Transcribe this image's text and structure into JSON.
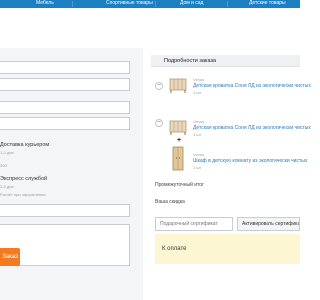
{
  "nav": {
    "items": [
      "Мебель",
      "Спортивные товары",
      "Дом и сад",
      "Детские товары"
    ]
  },
  "form": {
    "delivery_courier_label": "Доставка курьером",
    "delivery_courier_sub1": "1-2 дня",
    "delivery_courier_sub2": "300",
    "delivery_service_label": "Экспресс службой",
    "delivery_service_sub1": "2-3 дня",
    "delivery_service_sub2": "Расчёт при оформлении",
    "submit_label": "Заказ"
  },
  "order": {
    "title": "Подробности заказа",
    "items": [
      {
        "brand": "Venus",
        "name": "Детская кроватка Соня ЛД из экологически чистых",
        "qty": "1 шт"
      },
      {
        "brand": "Venus",
        "name": "Детская кроватка Соня ЛД из экологически чистых",
        "qty": "1 шт"
      },
      {
        "brand": "Venus",
        "name": "Шкаф в детскую комнату из экологически чистых",
        "qty": "1 шт"
      }
    ],
    "subtotal_label": "Промежуточный итог",
    "discount_label": "Ваша скидка",
    "certificate_placeholder": "Подарочный сертификат",
    "certificate_button": "Активировать сертификат",
    "total_label": "К оплате"
  },
  "colors": {
    "nav_bg": "#1c7fc1",
    "button_orange": "#f47a20",
    "link_blue": "#2a7cc0",
    "total_bg": "#fdf6d3"
  },
  "icons": [
    "remove-icon",
    "plus-icon",
    "crib-thumbnail",
    "wardrobe-thumbnail"
  ]
}
